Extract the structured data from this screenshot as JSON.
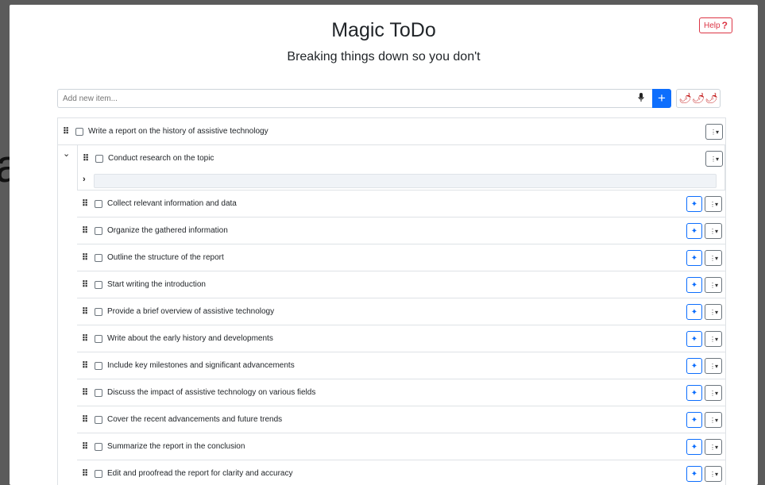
{
  "app": {
    "title": "Magic ToDo",
    "subtitle": "Breaking things down so you don't",
    "help_label": "Help",
    "help_icon": "?"
  },
  "background_text": "a",
  "new_item": {
    "placeholder": "Add new item...",
    "mic_icon": "microphone-icon",
    "add_label": "+",
    "spice_label": "🌶🌶🌶"
  },
  "tasks": {
    "root": "Write a report on the history of assistive technology",
    "children": [
      "Conduct research on the topic",
      "Collect relevant information and data",
      "Organize the gathered information",
      "Outline the structure of the report",
      "Start writing the introduction",
      "Provide a brief overview of assistive technology",
      "Write about the early history and developments",
      "Include key milestones and significant advancements",
      "Discuss the impact of assistive technology on various fields",
      "Cover the recent advancements and future trends",
      "Summarize the report in the conclusion",
      "Edit and proofread the report for clarity and accuracy"
    ]
  },
  "colors": {
    "primary": "#0d6efd",
    "danger": "#dc3545",
    "border": "#dee2e6"
  }
}
